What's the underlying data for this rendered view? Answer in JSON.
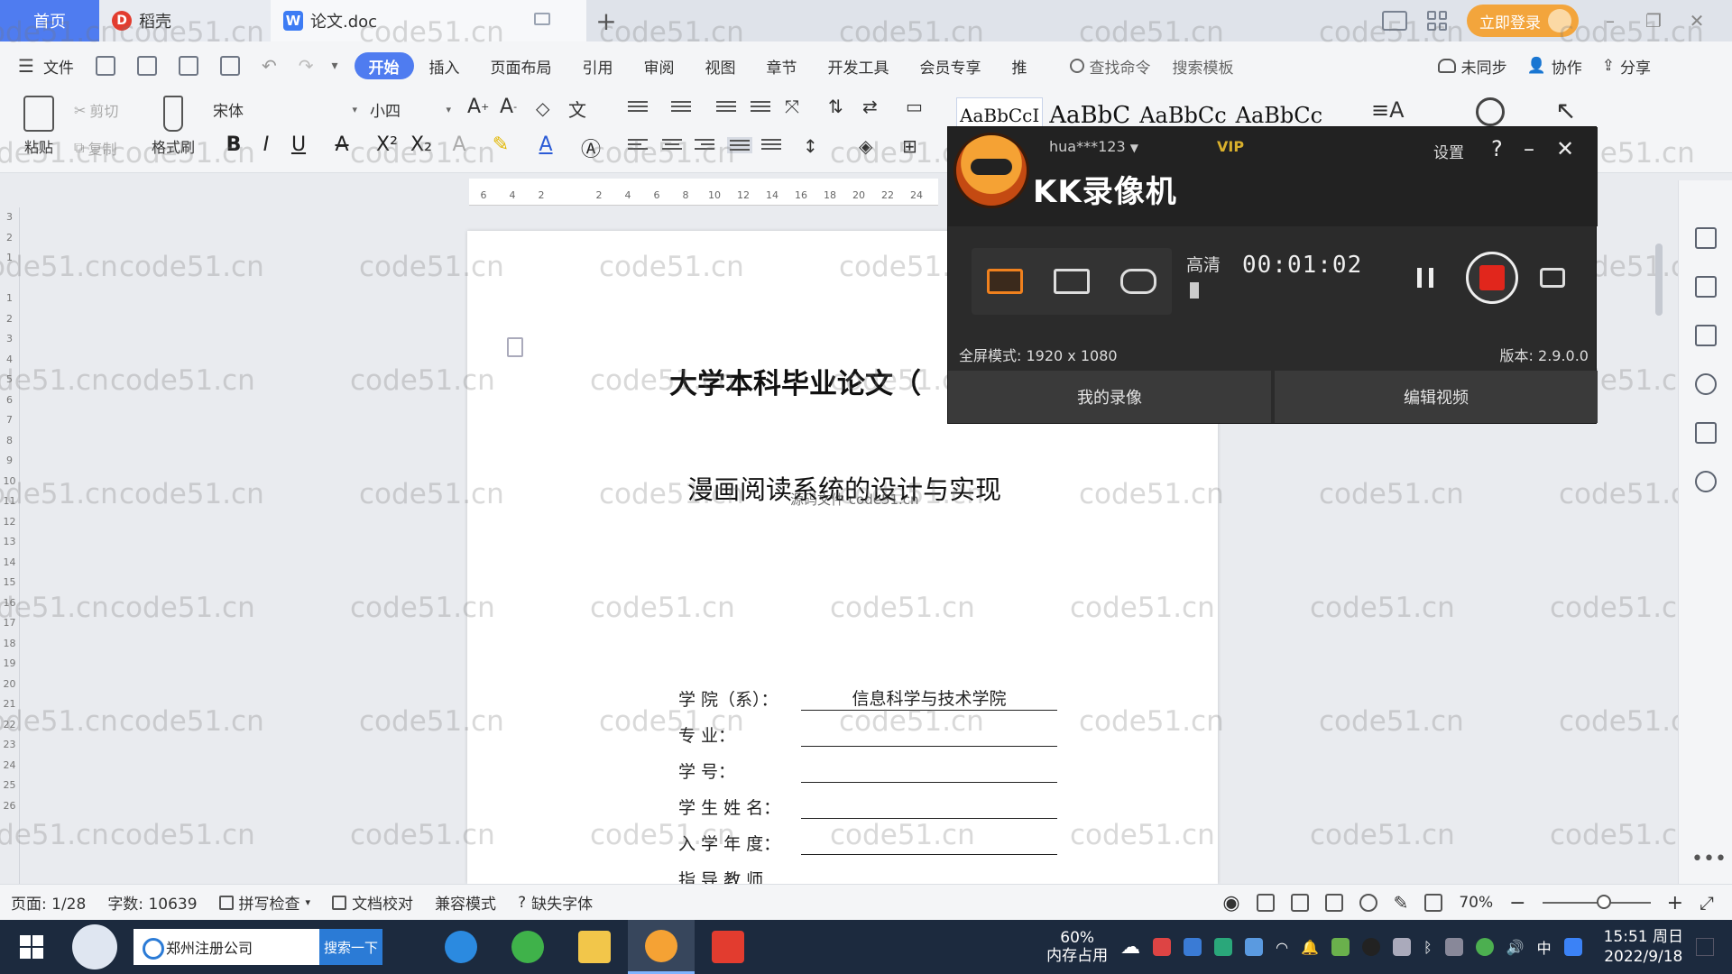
{
  "tabs": {
    "home": "首页",
    "daoke": "稻壳",
    "doc": "论文.doc",
    "add": "+"
  },
  "titlebar": {
    "login": "立即登录",
    "minimize": "–",
    "restore": "❐",
    "close": "✕"
  },
  "menu": {
    "file": "文件",
    "tabs": [
      "开始",
      "插入",
      "页面布局",
      "引用",
      "审阅",
      "视图",
      "章节",
      "开发工具",
      "会员专享",
      "推"
    ],
    "search_cmd": "查找命令",
    "search_tpl": "搜索模板",
    "unsynced": "未同步",
    "collab": "协作",
    "share": "分享"
  },
  "ribbon": {
    "paste": "粘贴",
    "cut": "剪切",
    "copy": "复制",
    "format_painter": "格式刷",
    "font": "宋体",
    "size": "小四",
    "bold": "B",
    "italic": "I",
    "underline": "U",
    "styles": [
      "AaBbCcI",
      "AaBbC",
      "AaBbCc",
      "AaBbCc"
    ]
  },
  "ruler": {
    "ticks": [
      "6",
      "4",
      "2",
      "",
      "2",
      "4",
      "6",
      "8",
      "10",
      "12",
      "14",
      "16",
      "18",
      "20",
      "22",
      "24"
    ]
  },
  "vruler": {
    "ticks": [
      "3",
      "2",
      "1",
      "",
      "1",
      "2",
      "3",
      "4",
      "5",
      "6",
      "7",
      "8",
      "9",
      "10",
      "11",
      "12",
      "13",
      "14",
      "15",
      "16",
      "17",
      "18",
      "19",
      "20",
      "21",
      "22",
      "23",
      "24",
      "25",
      "26"
    ]
  },
  "document": {
    "title": "大学本科毕业论文（",
    "subtitle": "漫画阅读系统的设计与实现",
    "overlay": "源码文件 code51.cn",
    "fields": [
      {
        "label": "学 院（系）：",
        "value": "信息科学与技术学院"
      },
      {
        "label": "专        业：",
        "value": ""
      },
      {
        "label": "学        号：",
        "value": ""
      },
      {
        "label": "学 生 姓 名：",
        "value": ""
      },
      {
        "label": "入 学 年 度：",
        "value": ""
      },
      {
        "label": "指 导 教 师",
        "value": ""
      }
    ]
  },
  "watermark": "code51.cn",
  "recorder": {
    "user": "hua***123",
    "vip": "VIP",
    "settings": "设置",
    "help": "?",
    "minimize": "–",
    "close": "✕",
    "name": "KK录像机",
    "quality": "高清",
    "timer": "00:01:02",
    "mode_text": "全屏模式: 1920 x 1080",
    "version": "版本: 2.9.0.0",
    "my_recordings": "我的录像",
    "edit_video": "编辑视频"
  },
  "status": {
    "page": "页面: 1/28",
    "words": "字数: 10639",
    "spell": "拼写检查",
    "proof": "文档校对",
    "compat": "兼容模式",
    "missing_font": "缺失字体",
    "zoom": "70%",
    "zoom_minus": "−",
    "zoom_plus": "+"
  },
  "taskbar": {
    "search_text": "郑州注册公司",
    "search_btn": "搜索一下",
    "mem_pct": "60%",
    "mem_label": "内存占用",
    "ime": "中",
    "time": "15:51 周日",
    "date": "2022/9/18"
  },
  "colors": {
    "accent": "#4f7cf0",
    "login": "#f3a53c",
    "record_red": "#e1261c",
    "taskbar": "#1c2a3e"
  }
}
